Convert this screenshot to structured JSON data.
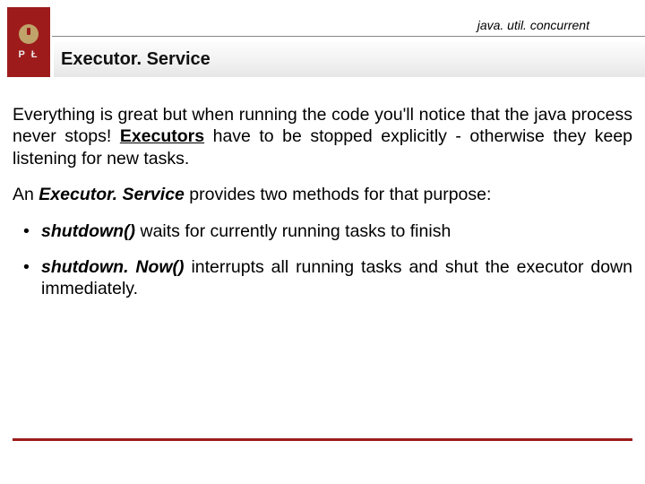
{
  "header": {
    "package_label": "java. util. concurrent",
    "logo_letters": "P    Ł",
    "title": "Executor. Service"
  },
  "body": {
    "p1_a": "Everything is great but when running the code you'll notice that the java process never stops! ",
    "p1_b_bold": "Executors",
    "p1_c": " have to be stopped explicitly - otherwise they keep listening for new tasks.",
    "p2_a": "An ",
    "p2_b_bold": "Executor. Service",
    "p2_c": " provides two methods for that purpose:",
    "bullets": [
      {
        "method": "shutdown()",
        "rest": " waits for currently running tasks to finish"
      },
      {
        "method": "shutdown. Now()",
        "rest": " interrupts all running tasks and shut the executor down immediately."
      }
    ]
  },
  "colors": {
    "accent": "#9e1b1b"
  }
}
